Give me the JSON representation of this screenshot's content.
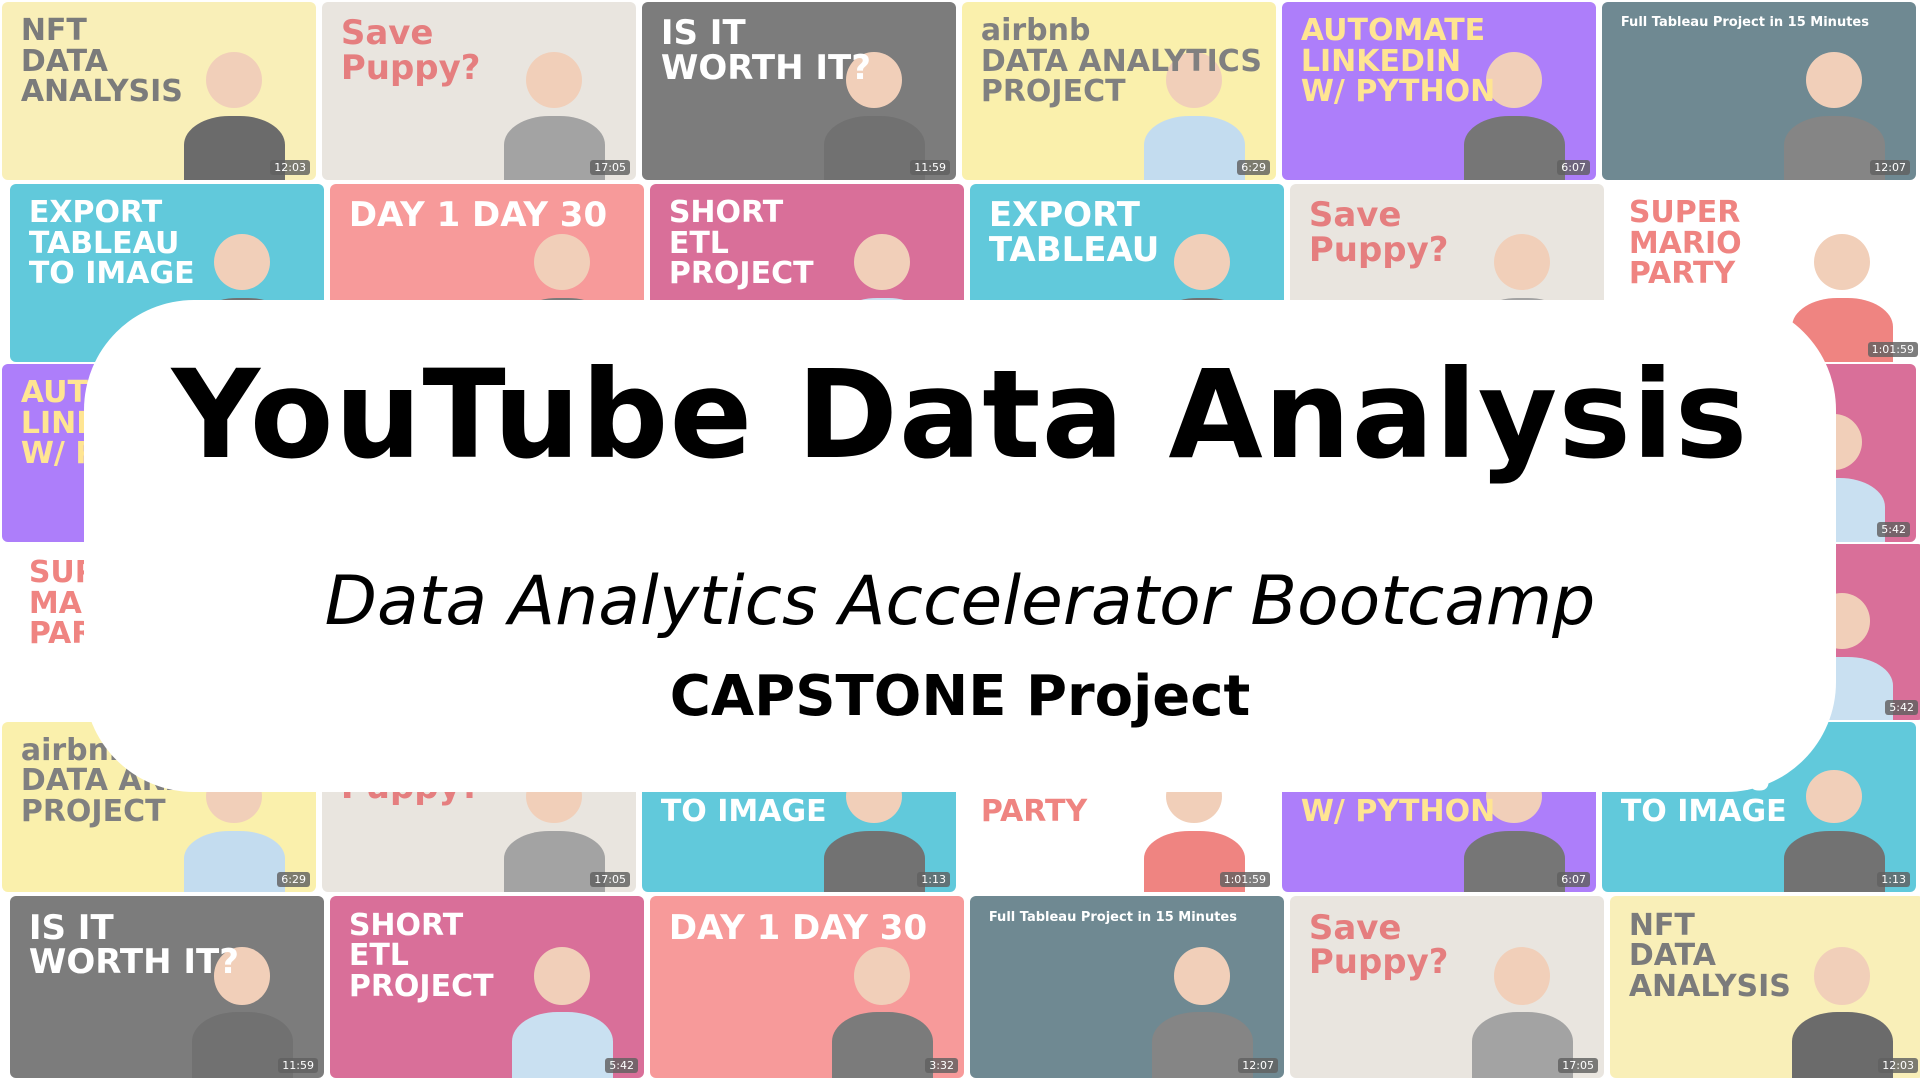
{
  "banner": {
    "title": "YouTube Data Analysis",
    "subtitle": "Data Analytics Accelerator Bootcamp",
    "tagline": "CAPSTONE Project"
  },
  "thumbnails": [
    {
      "title": "NFT\nDATA\nANALYSIS",
      "duration": "12:03",
      "bg": "#f6e58d",
      "fg": "#2b2b2b",
      "shirt": "#111111"
    },
    {
      "title": "Save\nPuppy?",
      "duration": "17:05",
      "bg": "#dcd6cc",
      "fg": "#d63031",
      "shirt": "#6b6b6b"
    },
    {
      "title": "IS IT\nWORTH IT?",
      "duration": "11:59",
      "bg": "#2d2d2d",
      "fg": "#ffffff",
      "shirt": "#1a1a1a"
    },
    {
      "title": "airbnb\nDATA ANALYTICS\nPROJECT",
      "duration": "6:29",
      "bg": "#f7e77a",
      "fg": "#333333",
      "shirt": "#9ec7e6"
    },
    {
      "title": "AUTOMATE\nLINKEDIN\nW/ PYTHON",
      "duration": "6:07",
      "bg": "#7b2ff7",
      "fg": "#ffd54f",
      "shirt": "#222222"
    },
    {
      "title": "Full Tableau Project in 15 Minutes",
      "duration": "12:07",
      "bg": "#17424f",
      "fg": "#ffffff",
      "shirt": "#3a3a3a"
    },
    {
      "title": "EXPORT\nTABLEAU\nTO IMAGE",
      "duration": "1:13",
      "bg": "#00a8c6",
      "fg": "#ffffff",
      "shirt": "#1c1c1c"
    },
    {
      "title": "DAY 1   DAY 30",
      "duration": "3:32",
      "bg": "#f25c5c",
      "fg": "#ffffff",
      "shirt": "#2a2a2a"
    },
    {
      "title": "SHORT\nETL\nPROJECT",
      "duration": "5:42",
      "bg": "#c2185b",
      "fg": "#ffffff",
      "shirt": "#a9cde8"
    },
    {
      "title": "EXPORT\nTABLEAU",
      "duration": "1:13",
      "bg": "#00a8c6",
      "fg": "#ffffff",
      "shirt": "#1c1c1c"
    },
    {
      "title": "Save\nPuppy?",
      "duration": "17:05",
      "bg": "#dcd6cc",
      "fg": "#d63031",
      "shirt": "#6b6b6b"
    },
    {
      "title": "SUPER\nMARIO\nPARTY",
      "duration": "1:01:59",
      "bg": "#ffffff",
      "fg": "#e53935",
      "shirt": "#e53935"
    }
  ],
  "colors": {
    "banner_bg": "#ffffff",
    "banner_text": "#000000"
  }
}
